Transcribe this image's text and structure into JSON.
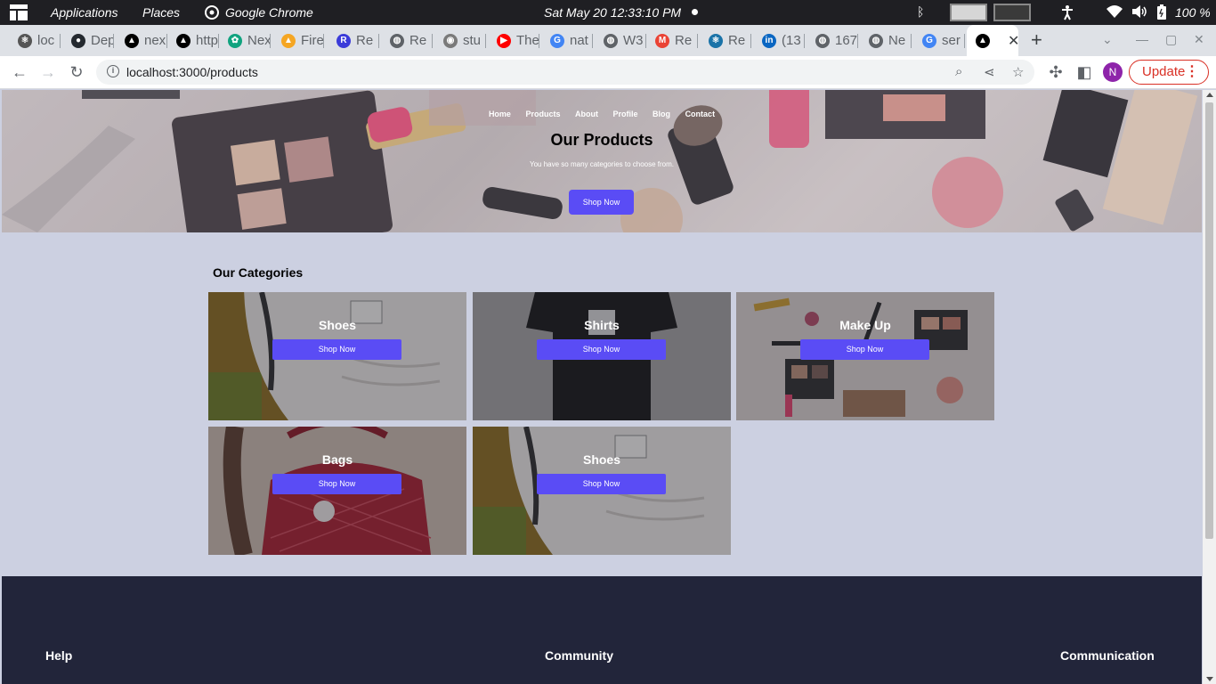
{
  "system_bar": {
    "applications": "Applications",
    "places": "Places",
    "browser": "Google Chrome",
    "clock": "Sat May 20  12:33:10 PM",
    "battery": "100 %"
  },
  "tabs": [
    {
      "label": "loc",
      "color": "#555555",
      "icon": "react-icon"
    },
    {
      "label": "Dep",
      "color": "#24292f",
      "icon": "github-icon"
    },
    {
      "label": "nex",
      "color": "#000000",
      "icon": "vercel-icon"
    },
    {
      "label": "http",
      "color": "#000000",
      "icon": "vercel-icon"
    },
    {
      "label": "Nex",
      "color": "#10a37f",
      "icon": "chatgpt-icon"
    },
    {
      "label": "Fire",
      "color": "#f5a623",
      "icon": "firebase-icon"
    },
    {
      "label": "Re",
      "color": "#3b3bd9",
      "icon": "r-icon"
    },
    {
      "label": "Re",
      "color": "#5f6368",
      "icon": "globe-icon"
    },
    {
      "label": "stu",
      "color": "#7a7a7a",
      "icon": "app-icon"
    },
    {
      "label": "The",
      "color": "#ff0000",
      "icon": "youtube-icon"
    },
    {
      "label": "nat",
      "color": "#4285f4",
      "icon": "google-icon"
    },
    {
      "label": "W3",
      "color": "#5f6368",
      "icon": "globe-icon"
    },
    {
      "label": "Re",
      "color": "#ea4335",
      "icon": "gmail-icon"
    },
    {
      "label": "Re",
      "color": "#1a73a8",
      "icon": "react-icon"
    },
    {
      "label": "(13",
      "color": "#0a66c2",
      "icon": "linkedin-icon"
    },
    {
      "label": "167",
      "color": "#5f6368",
      "icon": "globe-icon"
    },
    {
      "label": "Ne",
      "color": "#5f6368",
      "icon": "globe-icon"
    },
    {
      "label": "ser",
      "color": "#4285f4",
      "icon": "google-icon"
    }
  ],
  "address_bar": {
    "url": "localhost:3000/products"
  },
  "toolbar": {
    "avatar_letter": "N",
    "update_label": "Update"
  },
  "nav": {
    "items": [
      "Home",
      "Products",
      "About",
      "Profile",
      "Blog",
      "Contact"
    ]
  },
  "hero": {
    "title": "Our Products",
    "subtitle": "You have so many categories to choose from.",
    "button": "Shop Now"
  },
  "categories": {
    "heading": "Our Categories",
    "button_label": "Shop Now",
    "items": [
      {
        "name": "Shoes",
        "bg": "shoe"
      },
      {
        "name": "Shirts",
        "bg": "shirt"
      },
      {
        "name": "Make Up",
        "bg": "makeup"
      },
      {
        "name": "Bags",
        "bg": "bag"
      },
      {
        "name": "Shoes",
        "bg": "shoe"
      }
    ]
  },
  "footer": {
    "columns": [
      "Help",
      "Community",
      "Communication"
    ]
  },
  "colors": {
    "accent": "#5a4cf5",
    "page_bg": "#ccd0e1",
    "footer_bg": "#22253a"
  }
}
